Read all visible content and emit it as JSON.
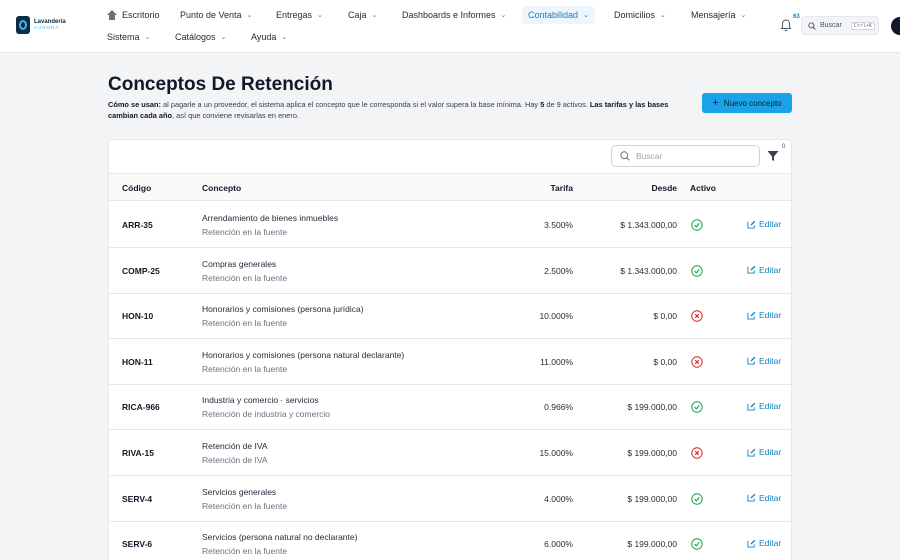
{
  "brand": {
    "name": "Lavandería",
    "sub": "AURORA"
  },
  "nav": {
    "row1": [
      {
        "label": "Escritorio",
        "icon": "home-icon"
      },
      {
        "label": "Punto de Venta"
      },
      {
        "label": "Entregas"
      },
      {
        "label": "Caja"
      },
      {
        "label": "Dashboards e Informes"
      },
      {
        "label": "Contabilidad",
        "active": true
      },
      {
        "label": "Domicilios"
      },
      {
        "label": "Mensajería"
      }
    ],
    "row2": [
      {
        "label": "Sistema"
      },
      {
        "label": "Catálogos"
      },
      {
        "label": "Ayuda"
      }
    ]
  },
  "header": {
    "notifications_count": "63",
    "search_label": "Buscar",
    "search_shortcut": "Ctrl+K"
  },
  "page": {
    "title": "Conceptos De Retención",
    "desc_lead": "Cómo se usan:",
    "desc_text1": " al pagarle a un proveedor, el sistema aplica el concepto que le corresponda si el valor supera la base mínima. Hay ",
    "desc_count_active": "5",
    "desc_text2": " de 9 activos. ",
    "desc_bold2": "Las tarifas y las bases cambian cada año",
    "desc_text3": ", así que conviene revisarlas en enero.",
    "new_button": "Nuevo concepto"
  },
  "table": {
    "search_placeholder": "Buscar",
    "filter_count": "0",
    "columns": {
      "code": "Código",
      "concept": "Concepto",
      "rate": "Tarifa",
      "since": "Desde",
      "active": "Activo"
    },
    "edit_label": "Editar",
    "rows": [
      {
        "code": "ARR-35",
        "concept": "Arrendamiento de bienes inmuebles",
        "type": "Retención en la fuente",
        "rate": "3.500%",
        "since": "$ 1.343.000,00",
        "active": true
      },
      {
        "code": "COMP-25",
        "concept": "Compras generales",
        "type": "Retención en la fuente",
        "rate": "2.500%",
        "since": "$ 1.343.000,00",
        "active": true
      },
      {
        "code": "HON-10",
        "concept": "Honorarios y comisiones (persona jurídica)",
        "type": "Retención en la fuente",
        "rate": "10.000%",
        "since": "$ 0,00",
        "active": false
      },
      {
        "code": "HON-11",
        "concept": "Honorarios y comisiones (persona natural declarante)",
        "type": "Retención en la fuente",
        "rate": "11.000%",
        "since": "$ 0,00",
        "active": false
      },
      {
        "code": "RICA-966",
        "concept": "Industria y comercio · servicios",
        "type": "Retención de industria y comercio",
        "rate": "0.966%",
        "since": "$ 199.000,00",
        "active": true
      },
      {
        "code": "RIVA-15",
        "concept": "Retención de IVA",
        "type": "Retención de IVA",
        "rate": "15.000%",
        "since": "$ 199.000,00",
        "active": false
      },
      {
        "code": "SERV-4",
        "concept": "Servicios generales",
        "type": "Retención en la fuente",
        "rate": "4.000%",
        "since": "$ 199.000,00",
        "active": true
      },
      {
        "code": "SERV-6",
        "concept": "Servicios (persona natural no declarante)",
        "type": "Retención en la fuente",
        "rate": "6.000%",
        "since": "$ 199.000,00",
        "active": true
      }
    ]
  },
  "colors": {
    "accent": "#1aa3e8",
    "link": "#0e7fc1",
    "ok": "#16a34a",
    "bad": "#dc2626"
  }
}
